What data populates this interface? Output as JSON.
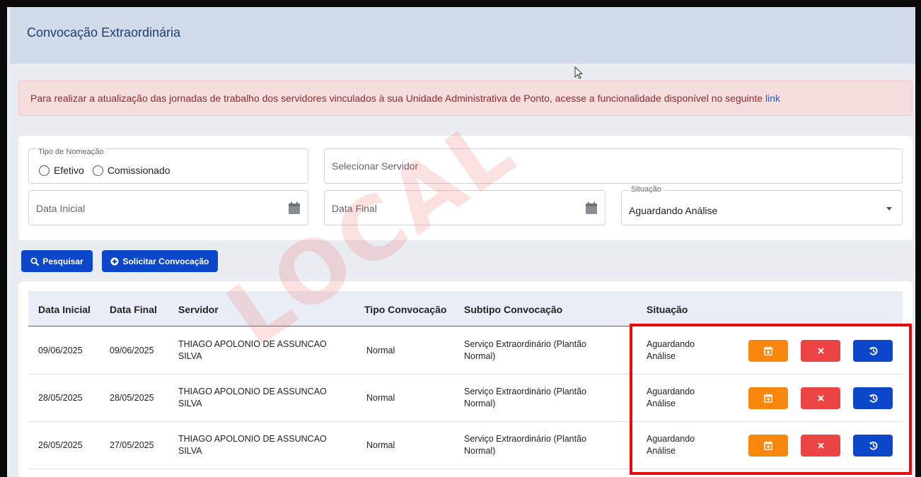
{
  "header": {
    "title": "Convocação Extraordinária"
  },
  "alert": {
    "text": "Para realizar a atualização das jornadas de trabalho dos servidores vinculados à sua Unidade Administrativa de Ponto, acesse a funcionalidade disponível no seguinte ",
    "link_text": "link"
  },
  "filters": {
    "tipo_nomeacao_label": "Tipo de Nomeação",
    "radio_options": [
      "Efetivo",
      "Comissionado"
    ],
    "servidor_placeholder": "Selecionar Servidor",
    "data_inicial_placeholder": "Data Inicial",
    "data_final_placeholder": "Data Final",
    "situacao_label": "Situação",
    "situacao_value": "Aguardando Análise"
  },
  "buttons": {
    "pesquisar": "Pesquisar",
    "solicitar": "Solicitar Convocação"
  },
  "watermark": "LOCAL",
  "table": {
    "headers": [
      "Data Inicial",
      "Data Final",
      "Servidor",
      "Tipo Convocação",
      "Subtipo Convocação",
      "Situação"
    ],
    "rows": [
      {
        "data_inicial": "09/06/2025",
        "data_final": "09/06/2025",
        "servidor_l1": "THIAGO APOLONIO DE ASSUNCAO",
        "servidor_l2": "SILVA",
        "tipo": "Normal",
        "subtipo_l1": "Serviço Extraordinário (Plantão",
        "subtipo_l2": "Normal)",
        "situacao_l1": "Aguardando",
        "situacao_l2": "Análise"
      },
      {
        "data_inicial": "28/05/2025",
        "data_final": "28/05/2025",
        "servidor_l1": "THIAGO APOLONIO DE ASSUNCAO",
        "servidor_l2": "SILVA",
        "tipo": "Normal",
        "subtipo_l1": "Serviço Extraordinário (Plantão",
        "subtipo_l2": "Normal)",
        "situacao_l1": "Aguardando",
        "situacao_l2": "Análise"
      },
      {
        "data_inicial": "26/05/2025",
        "data_final": "27/05/2025",
        "servidor_l1": "THIAGO APOLONIO DE ASSUNCAO",
        "servidor_l2": "SILVA",
        "tipo": "Normal",
        "subtipo_l1": "Serviço Extraordinário (Plantão",
        "subtipo_l2": "Normal)",
        "situacao_l1": "Aguardando",
        "situacao_l2": "Análise"
      }
    ]
  },
  "colors": {
    "primary_blue": "#0d47c9",
    "action_orange": "#f9870e",
    "action_red": "#ec4343",
    "highlight_red": "#e80a0a"
  },
  "icons": {
    "pesquisar": "search-icon",
    "solicitar": "plus-circle-icon",
    "date_fields": "calendar-icon",
    "row_actions": [
      "calendar-plus-icon",
      "close-icon",
      "history-icon"
    ]
  }
}
